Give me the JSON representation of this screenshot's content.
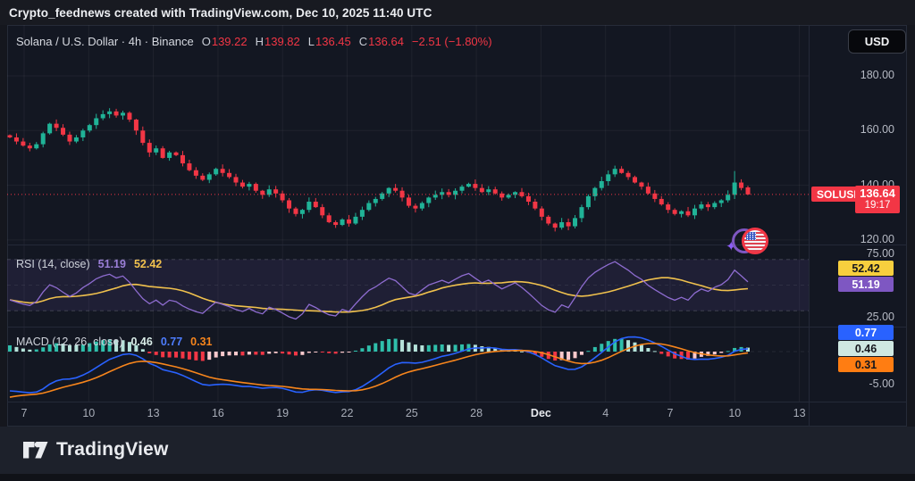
{
  "attribution": "Crypto_feednews created with TradingView.com, Dec 10, 2025 11:40 UTC",
  "currency_button": "USD",
  "symbol_legend": {
    "title": "Solana / U.S. Dollar · 4h · Binance",
    "o_label": "O",
    "o": "139.22",
    "h_label": "H",
    "h": "139.82",
    "l_label": "L",
    "l": "136.45",
    "c_label": "C",
    "c": "136.64",
    "change": "−2.51 (−1.80%)"
  },
  "price_axis": {
    "gridlines": [
      {
        "price": 180,
        "label": "180.00"
      },
      {
        "price": 160,
        "label": "160.00"
      },
      {
        "price": 140,
        "label": "140.00"
      },
      {
        "price": 120,
        "label": "120.00"
      }
    ],
    "last_price_badge": {
      "symbol": "SOLUSD",
      "price": "136.64",
      "countdown": "19:17"
    }
  },
  "rsi": {
    "legend_title": "RSI (14, close)",
    "line_value": "51.19",
    "ma_value": "52.42",
    "axis_upper": "75.00",
    "axis_lower": "25.00",
    "badge_ma": "52.42",
    "badge_line": "51.19",
    "levels": {
      "upper": 70,
      "middle": 50,
      "lower": 30
    }
  },
  "macd": {
    "legend_title": "MACD (12, 26, close)",
    "hist_value": "0.46",
    "macd_value": "0.77",
    "signal_value": "0.31",
    "axis_lower_label": "-5.00",
    "axis_lower_value": -5,
    "badge_macd": "0.77",
    "badge_hist": "0.46",
    "badge_signal": "0.31"
  },
  "time_axis": {
    "ticks": [
      "7",
      "10",
      "13",
      "16",
      "19",
      "22",
      "25",
      "28",
      "Dec",
      "4",
      "7",
      "10",
      "13"
    ],
    "emphasis_index": 8
  },
  "footer_logo_text": "TradingView",
  "colors": {
    "background": "#131722",
    "candle_up": "#20b397",
    "candle_down": "#f23645",
    "last_price": "#f23645",
    "grid": "rgba(255,255,255,0.05)",
    "rsi_line": "#8e6cd0",
    "rsi_band": "rgba(126,87,194,0.12)",
    "rsi_ma": "#f0c14d",
    "rsi_badge_ma_bg": "#f7cf3e",
    "rsi_badge_line_bg": "#7e57c2",
    "macd_line": "#2962ff",
    "macd_signal": "#f7851c",
    "hist_grow_above": "#2fbfab",
    "hist_fall_above": "#b5e3da",
    "hist_fall_below": "#f23645",
    "hist_grow_below": "#fbc9cc",
    "badge_macd_bg": "#2962ff",
    "badge_hist_bg": "#cfe8e2",
    "badge_signal_bg": "#ff7d12",
    "axis_text": "#b6bac4"
  },
  "chart_data": {
    "type": "candlestick+indicators",
    "symbol": "SOLUSD",
    "market": "Solana / U.S. Dollar",
    "interval": "4h",
    "exchange": "Binance",
    "ohlc_last": {
      "open": 139.22,
      "high": 139.82,
      "low": 136.45,
      "close": 136.64,
      "change": -2.51,
      "change_pct": -1.8
    },
    "price_gridlines": [
      180,
      160,
      140,
      120
    ],
    "visible_price_range": [
      119,
      199
    ],
    "x_tick_labels": [
      "7",
      "10",
      "13",
      "16",
      "19",
      "22",
      "25",
      "28",
      "Dec",
      "4",
      "7",
      "10",
      "13"
    ],
    "x_span": "Nov 7 - Dec 13 (3-day ticks, 4h candles)",
    "last_price": 136.64,
    "closes": [
      157.5,
      156,
      154.5,
      153.5,
      155,
      159,
      162.5,
      161,
      158.5,
      156,
      157.5,
      160,
      162,
      164.5,
      166,
      167,
      165.5,
      166.5,
      164,
      160,
      155.5,
      152,
      153.5,
      150,
      152,
      151,
      148,
      145.5,
      143.5,
      142,
      144,
      146,
      144.5,
      143,
      141,
      139.5,
      140.5,
      138,
      136.5,
      138.5,
      137,
      134.5,
      131.5,
      129.5,
      131,
      134,
      132,
      129,
      126.5,
      125.5,
      127.5,
      126,
      128.5,
      131,
      133.5,
      135,
      137,
      139,
      138,
      135.5,
      132.5,
      131.5,
      133.5,
      135.5,
      136.5,
      137.5,
      136.5,
      138,
      139.5,
      140.5,
      139,
      137.5,
      138.5,
      137,
      135.5,
      136.5,
      137.5,
      136,
      134,
      131.5,
      128.5,
      126,
      124.5,
      126.5,
      125,
      128,
      132,
      136,
      139,
      141.5,
      144,
      146,
      144.5,
      143,
      141,
      139.5,
      137,
      135,
      133,
      131,
      129.5,
      130.5,
      129,
      131.5,
      133,
      132,
      133.5,
      134.5,
      136.5,
      141,
      139,
      136.64
    ],
    "spike_high": {
      "index": 109,
      "high": 145.2
    },
    "rsi_current": 51.19,
    "rsi_ma_current": 52.42,
    "rsi_levels": [
      70,
      50,
      30
    ],
    "rsi_axis_labels": [
      75,
      25
    ],
    "macd_current": 0.77,
    "signal_current": 0.31,
    "histogram_current": 0.46,
    "macd_axis_label": -5,
    "indicator_note_rsi": "RSI (14, close) with 14-period MA",
    "indicator_note_macd": "MACD (12, 26, close) with 9-period signal"
  }
}
